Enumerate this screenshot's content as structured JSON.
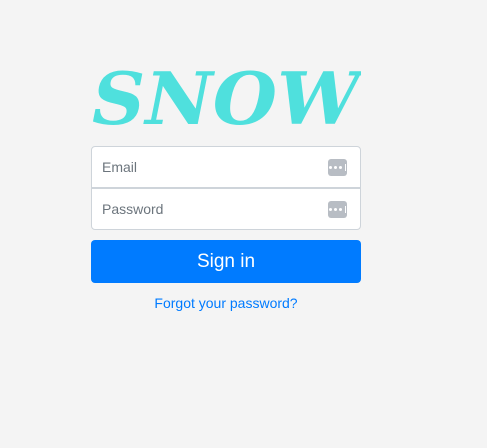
{
  "brand": {
    "logo_text": "SNOW",
    "logo_color": "#4fe0dd"
  },
  "form": {
    "email_placeholder": "Email",
    "email_value": "",
    "password_placeholder": "Password",
    "password_value": "",
    "field_icon": "password-manager-icon",
    "signin_label": "Sign in",
    "forgot_label": "Forgot your password?"
  },
  "colors": {
    "background": "#f4f4f4",
    "primary": "#007bff",
    "field_border": "#ced4da",
    "icon_gray": "#b8bdc4"
  }
}
